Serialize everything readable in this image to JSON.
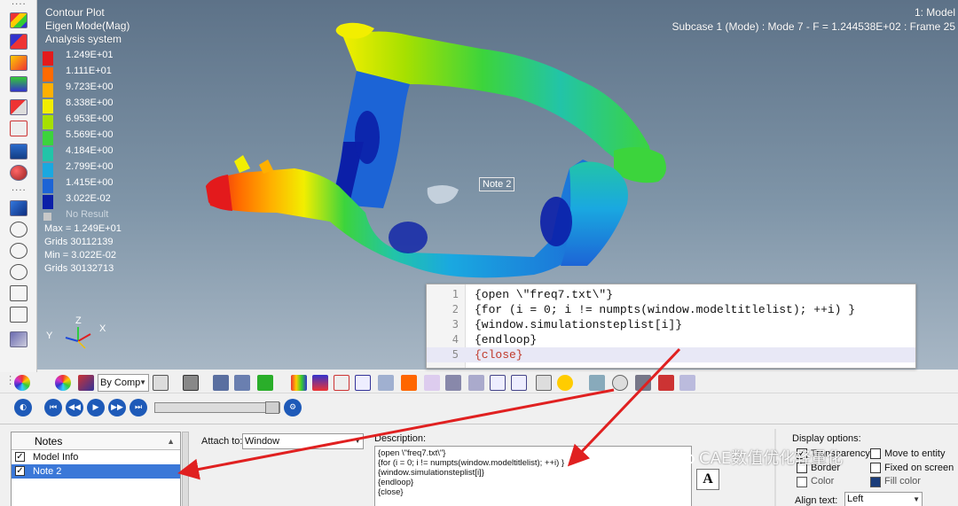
{
  "viewport": {
    "title_lines": [
      "Contour Plot",
      "Eigen Mode(Mag)",
      "Analysis system"
    ],
    "model_label": "1: Model",
    "subcase": "Subcase 1 (Mode) : Mode 7 - F = 1.244538E+02 : Frame 25"
  },
  "legend": {
    "entries": [
      {
        "label": "1.249E+01",
        "color": "#e31a1c"
      },
      {
        "label": "1.111E+01",
        "color": "#ff6a00"
      },
      {
        "label": "9.723E+00",
        "color": "#ffb000"
      },
      {
        "label": "8.338E+00",
        "color": "#f2ee00"
      },
      {
        "label": "6.953E+00",
        "color": "#a6e000"
      },
      {
        "label": "5.569E+00",
        "color": "#3cd43c"
      },
      {
        "label": "4.184E+00",
        "color": "#22c4a8"
      },
      {
        "label": "2.799E+00",
        "color": "#1aa8e0"
      },
      {
        "label": "1.415E+00",
        "color": "#1c64d6"
      },
      {
        "label": "3.022E-02",
        "color": "#0b1fa8"
      }
    ],
    "no_result": "No Result",
    "no_result_color": "#c8c8c8"
  },
  "stats": {
    "max": "Max = 1.249E+01",
    "max_grid": "Grids 30112139",
    "min": "Min = 3.022E-02",
    "min_grid": "Grids 30132713"
  },
  "axes": {
    "x": "X",
    "y": "Y",
    "z": "Z"
  },
  "note_tag": "Note 2",
  "code_panel": {
    "lines": [
      {
        "num": "1",
        "text": "{open \\\"freq7.txt\\\"}"
      },
      {
        "num": "2",
        "text": "{for (i = 0; i != numpts(window.modeltitlelist); ++i) }"
      },
      {
        "num": "3",
        "text": "{window.simulationsteplist[i]}"
      },
      {
        "num": "4",
        "text": "{endloop}"
      },
      {
        "num": "5",
        "text": "{close}"
      }
    ]
  },
  "toolbar": {
    "by_comp": "By Comp"
  },
  "notes_panel": {
    "header": "Notes",
    "items": [
      {
        "label": "Model Info",
        "checked": true
      },
      {
        "label": "Note 2",
        "checked": true,
        "selected": true
      }
    ],
    "attach_label": "Attach to:",
    "attach_value": "Window",
    "description_label": "Description:",
    "description_lines": [
      "{open \\\"freq7.txt\\\"}",
      "{for (i = 0; i != numpts(window.modeltitlelist); ++i) }",
      "{window.simulationsteplist[i]}",
      "{endloop}",
      "{close}"
    ],
    "display_options_label": "Display options:",
    "transparency": "Transparency",
    "move_to_entity": "Move to entity",
    "border": "Border",
    "fixed_on_screen": "Fixed on screen",
    "color": "Color",
    "fill_color": "Fill color",
    "align_label": "Align text:",
    "align_value": "Left"
  },
  "watermark": "CAE数值优化轻量化",
  "colors": {
    "accent_arrow": "#e02020",
    "selection": "#3b78d8"
  }
}
